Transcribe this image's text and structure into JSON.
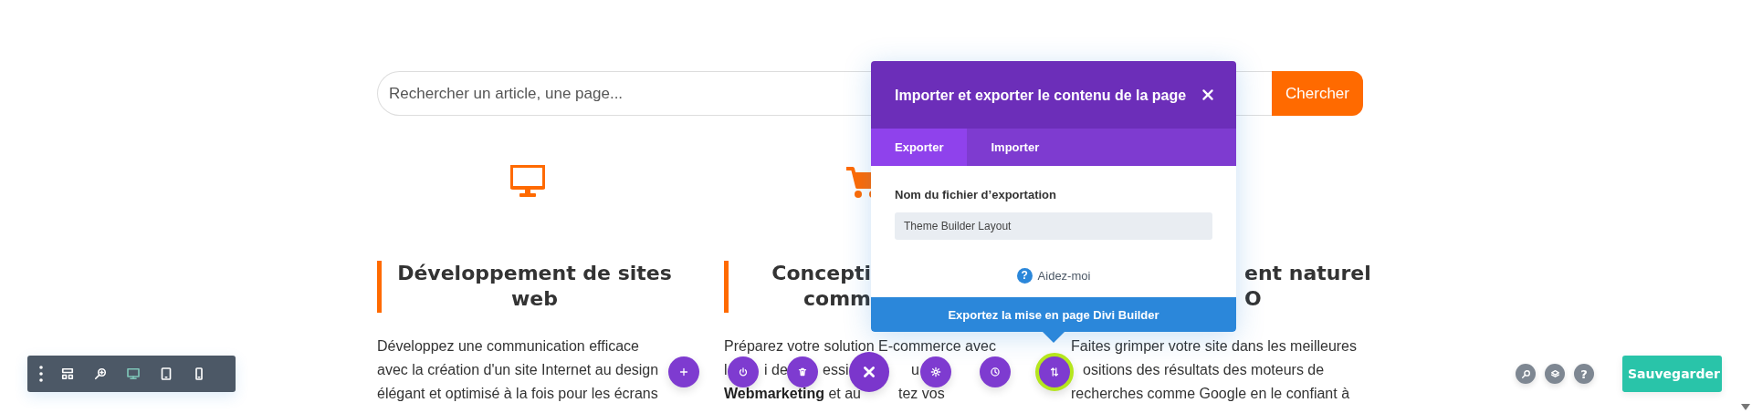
{
  "search": {
    "placeholder": "Rechercher un article, une page...",
    "button": "Chercher"
  },
  "services": [
    {
      "kind": "monitor",
      "heading_lines": [
        "Développement de sites",
        "web"
      ],
      "lines": [
        [
          "Développez une communication efficace"
        ],
        [
          "avec la création d'un site Internet au design"
        ],
        [
          "élégant et optimisé à la fois pour les écrans"
        ]
      ]
    },
    {
      "kind": "cart",
      "heading_lines": [
        "Concepti",
        "comm"
      ],
      "lines": [
        [
          "Préparez votre solution E-commerce avec"
        ],
        [
          "l",
          "i de",
          "essi",
          "u"
        ],
        [
          "**Webmarketing** et au",
          "tez vos"
        ]
      ]
    },
    {
      "heading_lines": [
        "ent naturel",
        "O"
      ],
      "lines": [
        [
          "Faites grimper votre site dans les meilleures"
        ],
        [
          "ositions des résultats des moteurs de"
        ],
        [
          "recherches comme Google en le confiant à"
        ]
      ]
    }
  ],
  "modal": {
    "title": "Importer et exporter le contenu de la page",
    "tabs": [
      {
        "label": "Exporter",
        "selected": true
      },
      {
        "label": "Importer",
        "selected": false
      }
    ],
    "field_label": "Nom du fichier d’exportation",
    "field_value": "Theme Builder Layout",
    "help_icon": "?",
    "help": "Aidez-moi",
    "export_button": "Exportez la mise en page Divi Builder"
  },
  "actions": [
    {
      "kind": "add",
      "active": false
    },
    {
      "kind": "power",
      "active": false
    },
    {
      "kind": "trash",
      "active": false
    },
    {
      "kind": "close",
      "active": false
    },
    {
      "kind": "gear",
      "active": false
    },
    {
      "kind": "history",
      "active": false
    },
    {
      "kind": "import-export",
      "active": true
    }
  ],
  "view_modes": [
    {
      "kind": "menu",
      "selected": false
    },
    {
      "kind": "wireframe",
      "selected": false
    },
    {
      "kind": "zoom",
      "selected": false
    },
    {
      "kind": "desktop",
      "selected": true
    },
    {
      "kind": "tablet",
      "selected": false
    },
    {
      "kind": "phone",
      "selected": false
    }
  ],
  "utilities": [
    {
      "kind": "search"
    },
    {
      "kind": "layers"
    },
    {
      "kind": "help",
      "label": "?"
    }
  ],
  "save_button": "Sauvegarder"
}
